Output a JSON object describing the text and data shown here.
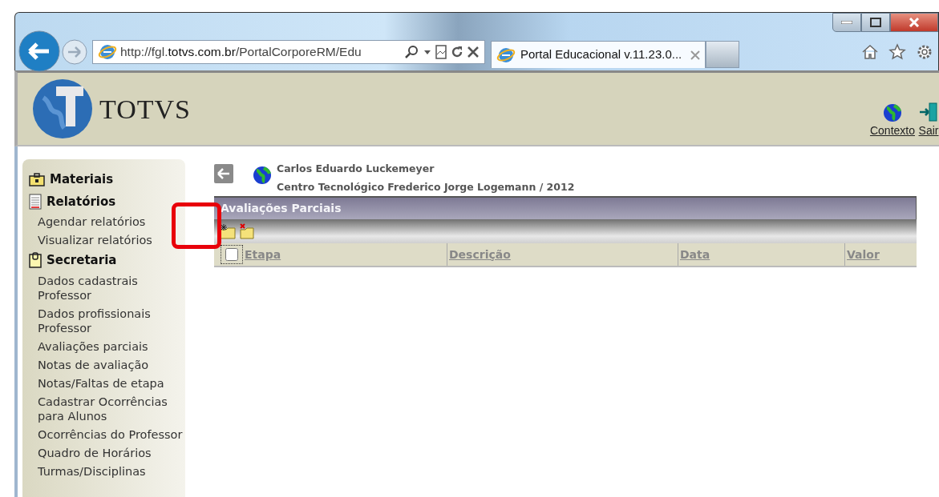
{
  "browser": {
    "url": "http://fgl.**totvs.com.br**/PortalCorporeRM/Edu",
    "tab_title": "Portal Educacional v.11.23.0..."
  },
  "header": {
    "logo_text": "TOTVS",
    "links": [
      {
        "label": "Contexto",
        "kind": "globe"
      },
      {
        "label": "Sair",
        "kind": "exit"
      }
    ]
  },
  "sidebar": {
    "sections": [
      {
        "title": "Materiais",
        "kind": "briefcase"
      },
      {
        "title": "Relatórios",
        "kind": "report",
        "items": [
          "Agendar relatórios",
          "Visualizar relatórios"
        ]
      },
      {
        "title": "Secretaria",
        "kind": "clipboard",
        "items": [
          "Dados cadastrais Professor",
          "Dados profissionais Professor",
          "Avaliações parciais",
          "Notas de avaliação",
          "Notas/Faltas de etapa",
          "Cadastrar Ocorrências para Alunos",
          "Ocorrências do Professor",
          "Quadro de Horários",
          "Turmas/Disciplinas"
        ]
      }
    ]
  },
  "main": {
    "user_name": "Carlos Eduardo Luckemeyer",
    "institution": "Centro Tecnológico Frederico Jorge Logemann / 2012",
    "panel_title": "Avaliações Parciais",
    "table": {
      "select_all_checked": false,
      "columns": [
        "Etapa",
        "Descrição",
        "Data",
        "Valor"
      ]
    }
  }
}
